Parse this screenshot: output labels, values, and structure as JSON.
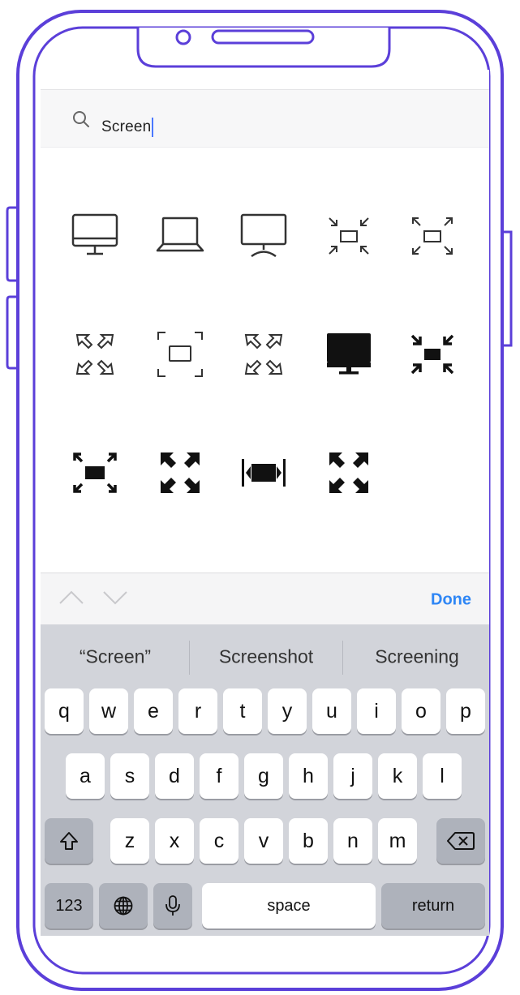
{
  "search": {
    "query": "Screen"
  },
  "icons": [
    {
      "name": "desktop-monitor-outline-icon"
    },
    {
      "name": "laptop-outline-icon"
    },
    {
      "name": "monitor-stand-outline-icon"
    },
    {
      "name": "exit-fullscreen-small-outline-icon"
    },
    {
      "name": "fullscreen-small-outline-icon"
    },
    {
      "name": "expand-arrows-outline-icon"
    },
    {
      "name": "screen-frame-outline-icon"
    },
    {
      "name": "expand-arrows-outline-alt-icon"
    },
    {
      "name": "desktop-monitor-filled-icon"
    },
    {
      "name": "exit-fullscreen-filled-icon"
    },
    {
      "name": "fullscreen-filled-icon"
    },
    {
      "name": "expand-arrows-filled-icon"
    },
    {
      "name": "fit-width-filled-icon"
    },
    {
      "name": "expand-arrows-bold-icon"
    }
  ],
  "accessory": {
    "done_label": "Done"
  },
  "keyboard": {
    "suggestions": [
      "“Screen”",
      "Screenshot",
      "Screening"
    ],
    "row1": [
      "q",
      "w",
      "e",
      "r",
      "t",
      "y",
      "u",
      "i",
      "o",
      "p"
    ],
    "row2": [
      "a",
      "s",
      "d",
      "f",
      "g",
      "h",
      "j",
      "k",
      "l"
    ],
    "row3": [
      "z",
      "x",
      "c",
      "v",
      "b",
      "n",
      "m"
    ],
    "numbers_label": "123",
    "space_label": "space",
    "return_label": "return"
  },
  "colors": {
    "frame": "#5b3fd9",
    "accent": "#2e86f5"
  }
}
